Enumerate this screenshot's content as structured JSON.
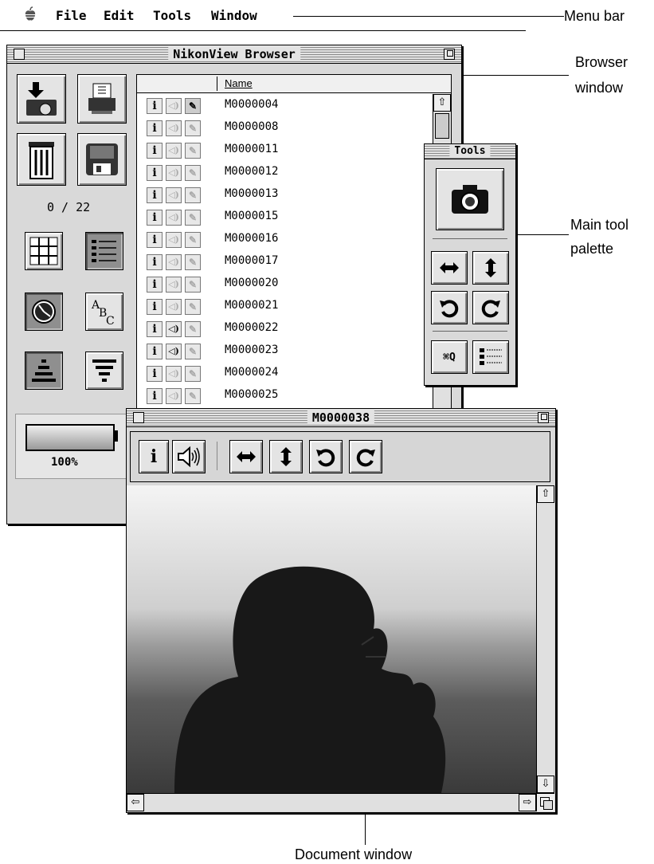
{
  "menubar": {
    "apple_icon": "apple-icon",
    "items": [
      "File",
      "Edit",
      "Tools",
      "Window"
    ]
  },
  "callouts": {
    "menu_bar": "Menu bar",
    "browser_window_line1": "Browser",
    "browser_window_line2": "window",
    "tool_palette_line1": "Main tool",
    "tool_palette_line2": "palette",
    "document_window": "Document window"
  },
  "browser": {
    "title": "NikonView Browser",
    "counter": "0 / 22",
    "battery": "100%",
    "column_header": "Name",
    "rows": [
      {
        "name": "M0000004",
        "sound": false,
        "edit_active": true
      },
      {
        "name": "M0000008",
        "sound": false,
        "edit_active": false
      },
      {
        "name": "M0000011",
        "sound": false,
        "edit_active": false
      },
      {
        "name": "M0000012",
        "sound": false,
        "edit_active": false
      },
      {
        "name": "M0000013",
        "sound": false,
        "edit_active": false
      },
      {
        "name": "M0000015",
        "sound": false,
        "edit_active": false
      },
      {
        "name": "M0000016",
        "sound": false,
        "edit_active": false
      },
      {
        "name": "M0000017",
        "sound": false,
        "edit_active": false
      },
      {
        "name": "M0000020",
        "sound": false,
        "edit_active": false
      },
      {
        "name": "M0000021",
        "sound": false,
        "edit_active": false
      },
      {
        "name": "M0000022",
        "sound": true,
        "edit_active": false
      },
      {
        "name": "M0000023",
        "sound": true,
        "edit_active": false
      },
      {
        "name": "M0000024",
        "sound": false,
        "edit_active": false
      },
      {
        "name": "M0000025",
        "sound": false,
        "edit_active": false
      }
    ]
  },
  "tools": {
    "title": "Tools",
    "quit_label": "⌘Q"
  },
  "document": {
    "title": "M0000038",
    "info_label": "i"
  }
}
